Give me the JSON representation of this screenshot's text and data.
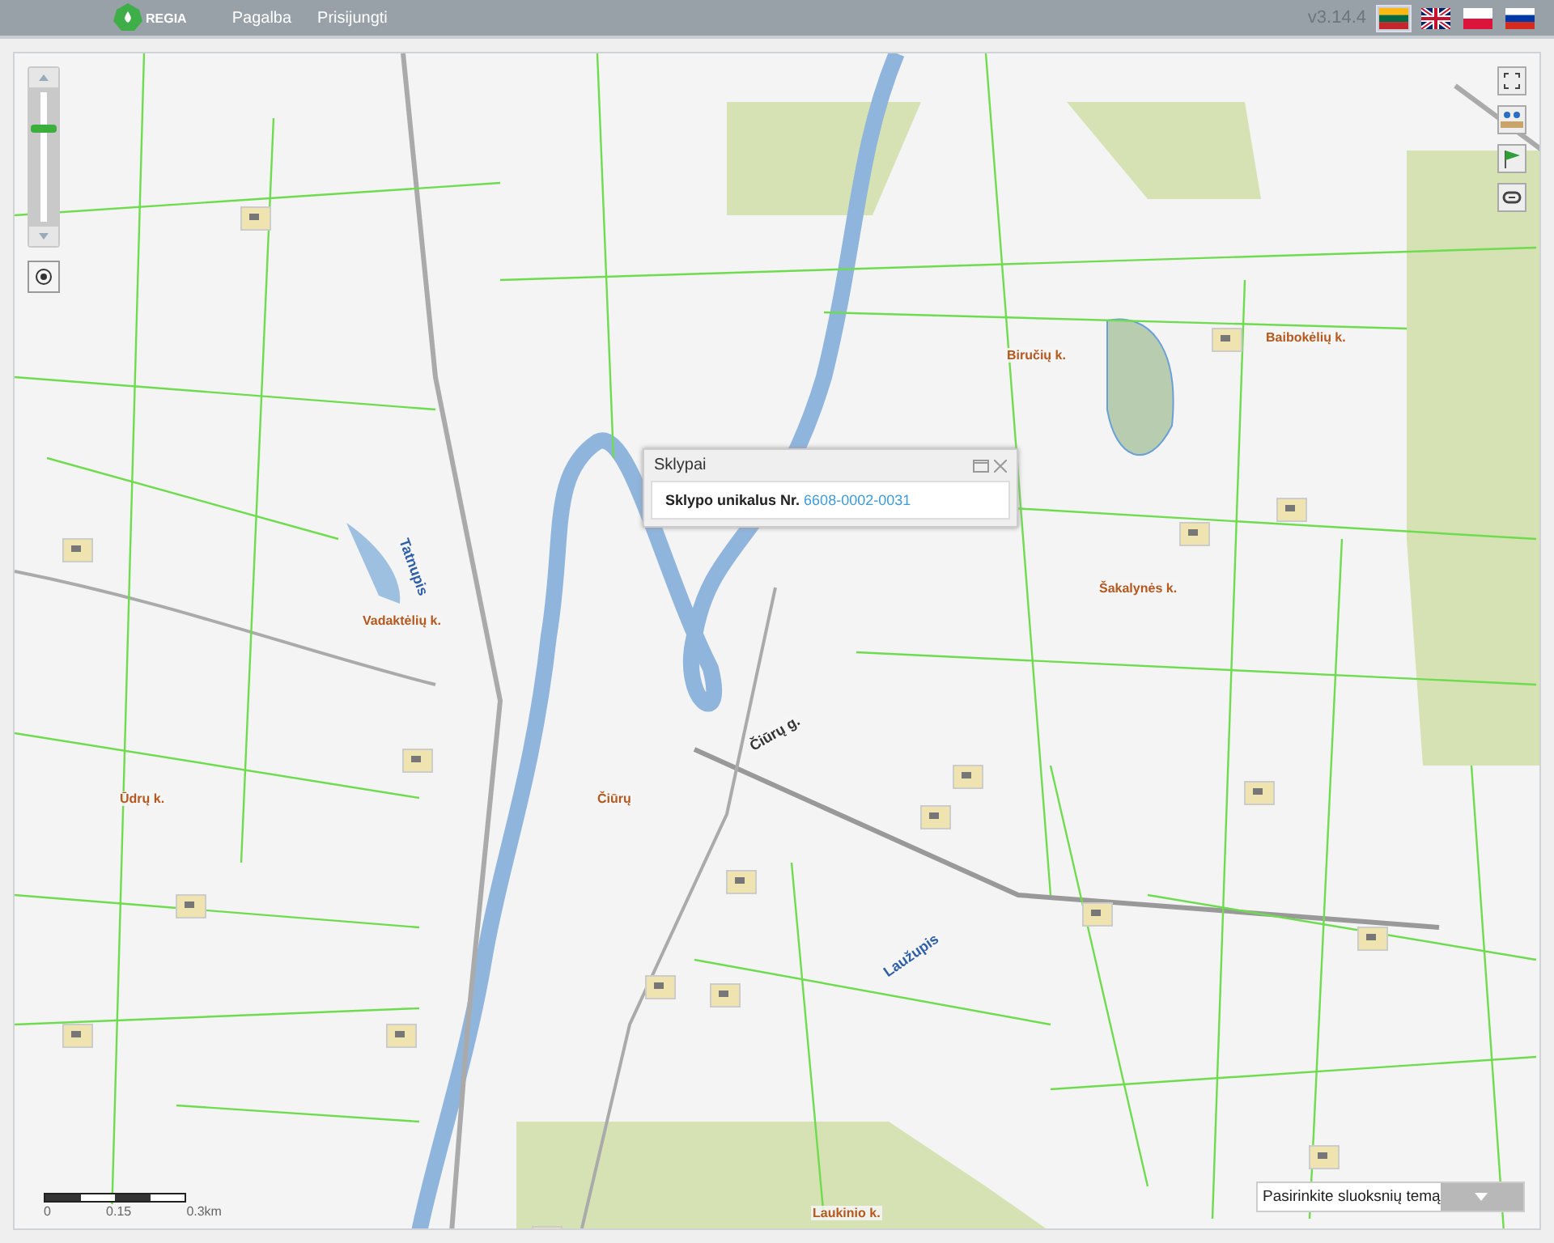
{
  "header": {
    "logo_text": "REGIA",
    "nav": [
      {
        "label": "Pagalba"
      },
      {
        "label": "Prisijungti"
      }
    ],
    "version": "v3.14.4",
    "languages": [
      {
        "selected": true
      },
      {
        "selected": false
      },
      {
        "selected": false
      },
      {
        "selected": false
      }
    ]
  },
  "map": {
    "zoom": {
      "level": 0.72
    },
    "labels": [
      {
        "text": "Biručių k.",
        "kind": "village"
      },
      {
        "text": "Baibokėlių k.",
        "kind": "village"
      },
      {
        "text": "Vadaktėlių k.",
        "kind": "village"
      },
      {
        "text": "Šakalynės k.",
        "kind": "village"
      },
      {
        "text": "Ūdrų k.",
        "kind": "village"
      },
      {
        "text": "Čiūrų",
        "kind": "village"
      },
      {
        "text": "Laukinio k.",
        "kind": "village"
      },
      {
        "text": "Čiūrų g.",
        "kind": "street"
      },
      {
        "text": "Tatnupis",
        "kind": "river"
      },
      {
        "text": "Laužupis",
        "kind": "river"
      }
    ],
    "popup": {
      "title": "Sklypai",
      "label": "Sklypo unikalus Nr.",
      "link": "6608-0002-0031"
    },
    "scale": {
      "ticks": [
        "0",
        "0.15",
        "0.3km"
      ]
    },
    "theme_select": {
      "placeholder": "Pasirinkite sluoksnių temą"
    }
  }
}
